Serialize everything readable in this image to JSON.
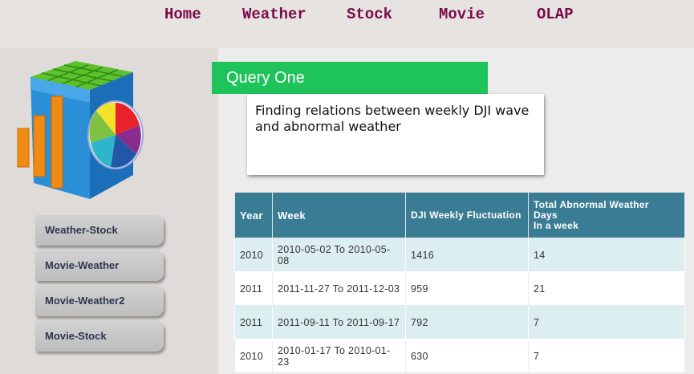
{
  "nav": {
    "items": [
      {
        "label": "Home"
      },
      {
        "label": "Weather"
      },
      {
        "label": "Stock"
      },
      {
        "label": "Movie"
      },
      {
        "label": "OLAP"
      }
    ]
  },
  "sidebar": {
    "items": [
      {
        "label": "Weather-Stock"
      },
      {
        "label": "Movie-Weather"
      },
      {
        "label": "Movie-Weather2"
      },
      {
        "label": "Movie-Stock"
      }
    ],
    "logo_icon": "data-cube-chart-icon"
  },
  "main": {
    "query_title": "Query One",
    "description": "Finding relations between weekly DJI wave and abnormal weather"
  },
  "table": {
    "headers": {
      "year": "Year",
      "week": "Week",
      "dji": "DJI Weekly Fluctuation",
      "abnormal_line1": "Total Abnormal Weather",
      "abnormal_line2": "Days",
      "abnormal_line3": "In a week"
    },
    "rows": [
      {
        "year": "2010",
        "week": "2010-05-02 To 2010-05-08",
        "dji": "1416",
        "days": "14"
      },
      {
        "year": "2011",
        "week": "2011-11-27 To 2011-12-03",
        "dji": "959",
        "days": "21"
      },
      {
        "year": "2011",
        "week": "2011-09-11 To 2011-09-17",
        "dji": "792",
        "days": "7"
      },
      {
        "year": "2010",
        "week": "2010-01-17 To 2010-01-23",
        "dji": "630",
        "days": "7"
      }
    ]
  },
  "colors": {
    "nav_text": "#7a0c4a",
    "query_header": "#1ec45a",
    "table_header": "#3b7c95",
    "row_alt": "#ddeef1"
  }
}
